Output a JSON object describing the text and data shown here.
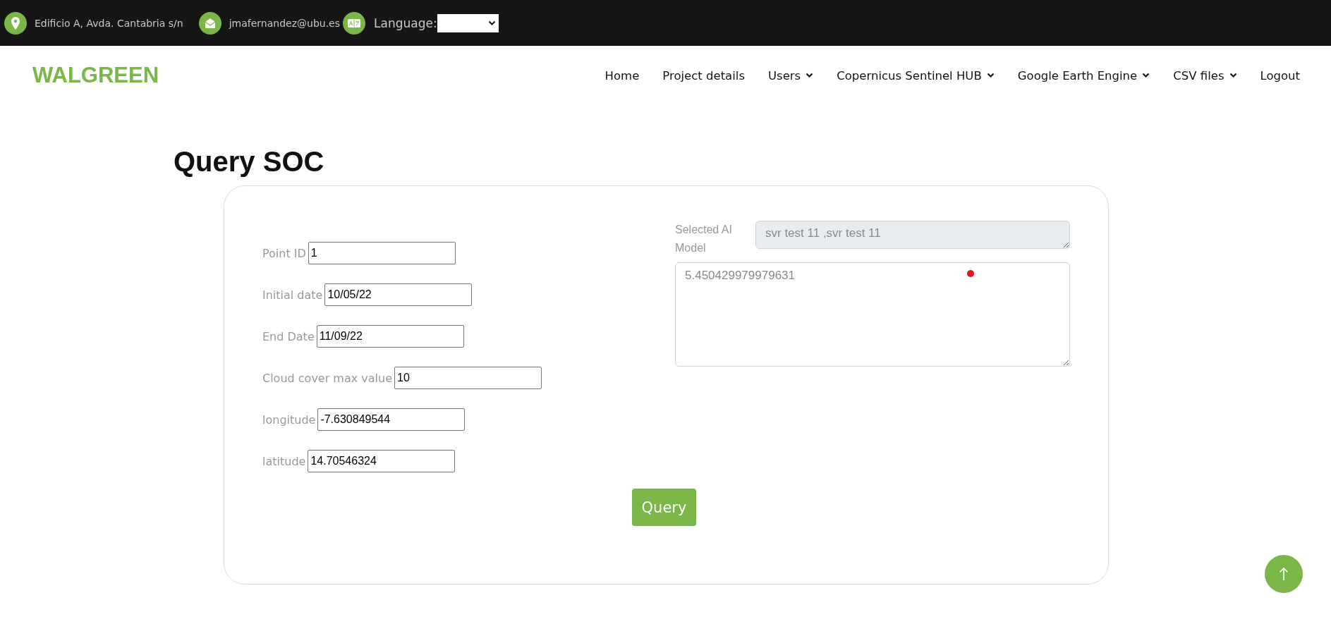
{
  "top_bar": {
    "address": "Edificio A, Avda. Cantabria s/n",
    "email": "jmafernandez@ubu.es",
    "language_label": "Language:"
  },
  "navbar": {
    "logo": "WALGREEN",
    "items": [
      {
        "label": "Home",
        "dropdown": false
      },
      {
        "label": "Project details",
        "dropdown": false
      },
      {
        "label": "Users",
        "dropdown": true
      },
      {
        "label": "Copernicus Sentinel HUB",
        "dropdown": true
      },
      {
        "label": "Google Earth Engine",
        "dropdown": true
      },
      {
        "label": "CSV files",
        "dropdown": true
      },
      {
        "label": "Logout",
        "dropdown": false
      }
    ]
  },
  "page_title": "Query SOC",
  "form": {
    "fields": [
      {
        "label": "Point ID",
        "value": "1"
      },
      {
        "label": "Initial date",
        "value": "10/05/22"
      },
      {
        "label": "End Date",
        "value": "11/09/22"
      },
      {
        "label": "Cloud cover max value",
        "value": "10"
      },
      {
        "label": "longitude",
        "value": "-7.630849544"
      },
      {
        "label": "latitude",
        "value": "14.70546324"
      }
    ],
    "model_label": "Selected AI Model",
    "model_value": "svr test 11 ,svr test 11",
    "result": "5.450429979979631",
    "submit": "Query"
  }
}
